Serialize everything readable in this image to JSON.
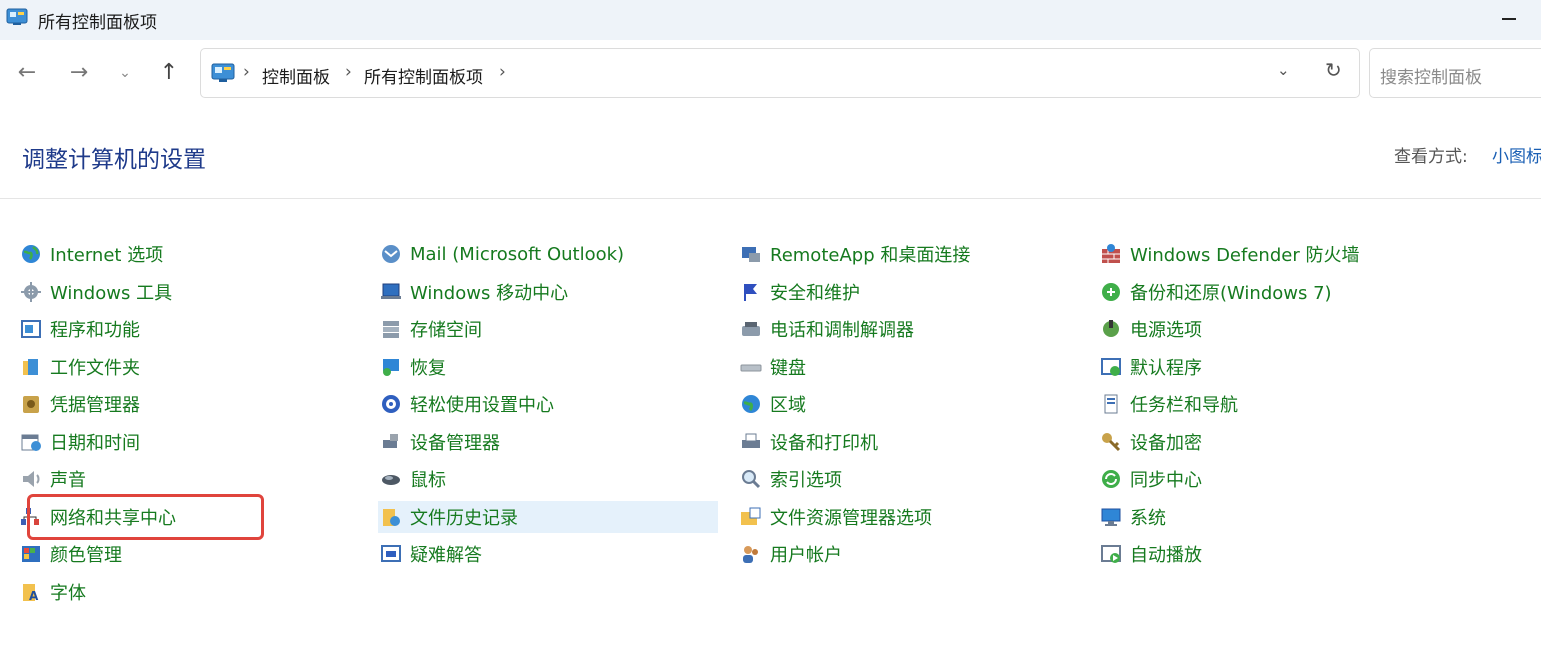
{
  "window": {
    "title": "所有控制面板项"
  },
  "nav": {
    "back_icon": "←",
    "forward_icon": "→",
    "recent_icon": "⌄",
    "up_icon": "↑",
    "breadcrumb": [
      "控制面板",
      "所有控制面板项"
    ],
    "separator": "›",
    "dropdown_icon": "⌄",
    "refresh_icon": "↻",
    "search_placeholder": "搜索控制面板"
  },
  "header": {
    "title": "调整计算机的设置",
    "view_by_label": "查看方式:",
    "view_by_value": "小图标"
  },
  "columns": [
    [
      {
        "label": "Internet 选项",
        "icon": "globe-icon"
      },
      {
        "label": "Windows 工具",
        "icon": "gear-icon"
      },
      {
        "label": "程序和功能",
        "icon": "programs-icon"
      },
      {
        "label": "工作文件夹",
        "icon": "folder-icon"
      },
      {
        "label": "凭据管理器",
        "icon": "credential-icon"
      },
      {
        "label": "日期和时间",
        "icon": "calendar-icon"
      },
      {
        "label": "声音",
        "icon": "speaker-icon"
      },
      {
        "label": "网络和共享中心",
        "icon": "network-icon"
      },
      {
        "label": "颜色管理",
        "icon": "color-icon"
      },
      {
        "label": "字体",
        "icon": "font-icon"
      }
    ],
    [
      {
        "label": "Mail (Microsoft Outlook)",
        "icon": "mail-icon"
      },
      {
        "label": "Windows 移动中心",
        "icon": "mobility-icon"
      },
      {
        "label": "存储空间",
        "icon": "storage-icon"
      },
      {
        "label": "恢复",
        "icon": "recovery-icon"
      },
      {
        "label": "轻松使用设置中心",
        "icon": "accessibility-icon"
      },
      {
        "label": "设备管理器",
        "icon": "device-manager-icon"
      },
      {
        "label": "鼠标",
        "icon": "mouse-icon"
      },
      {
        "label": "文件历史记录",
        "icon": "file-history-icon"
      },
      {
        "label": "疑难解答",
        "icon": "troubleshoot-icon"
      }
    ],
    [
      {
        "label": "RemoteApp 和桌面连接",
        "icon": "remote-icon"
      },
      {
        "label": "安全和维护",
        "icon": "flag-icon"
      },
      {
        "label": "电话和调制解调器",
        "icon": "phone-icon"
      },
      {
        "label": "键盘",
        "icon": "keyboard-icon"
      },
      {
        "label": "区域",
        "icon": "region-icon"
      },
      {
        "label": "设备和打印机",
        "icon": "printer-icon"
      },
      {
        "label": "索引选项",
        "icon": "search-index-icon"
      },
      {
        "label": "文件资源管理器选项",
        "icon": "explorer-options-icon"
      },
      {
        "label": "用户帐户",
        "icon": "users-icon"
      }
    ],
    [
      {
        "label": "Windows Defender 防火墙",
        "icon": "firewall-icon"
      },
      {
        "label": "备份和还原(Windows 7)",
        "icon": "backup-icon"
      },
      {
        "label": "电源选项",
        "icon": "power-icon"
      },
      {
        "label": "默认程序",
        "icon": "default-programs-icon"
      },
      {
        "label": "任务栏和导航",
        "icon": "taskbar-icon"
      },
      {
        "label": "设备加密",
        "icon": "key-icon"
      },
      {
        "label": "同步中心",
        "icon": "sync-icon"
      },
      {
        "label": "系统",
        "icon": "monitor-icon"
      },
      {
        "label": "自动播放",
        "icon": "autoplay-icon"
      }
    ]
  ],
  "state": {
    "hovered_item": "文件历史记录",
    "highlighted_item": "网络和共享中心"
  },
  "colors": {
    "link": "#167a1f",
    "title": "#1e3a8a",
    "hover_bg": "#e5f1fb",
    "highlight_border": "#e0443c"
  }
}
